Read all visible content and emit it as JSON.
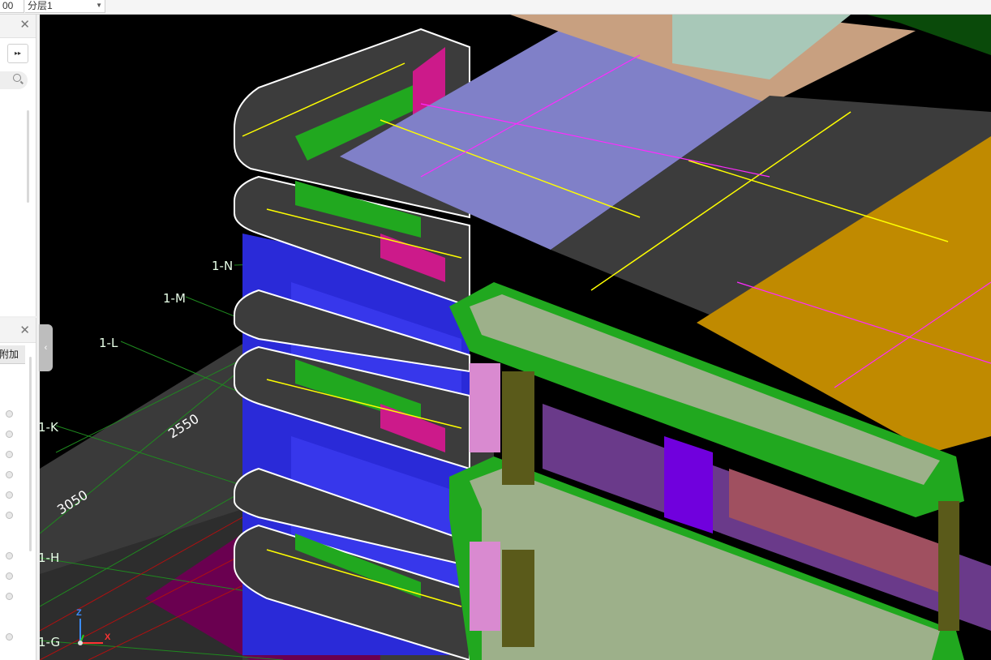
{
  "toolbar": {
    "scale_value": "00",
    "layer_value": "分层1"
  },
  "left_panel_bottom": {
    "tab_label": "附加"
  },
  "viewport": {
    "axis_labels": [
      "1-N",
      "1-M",
      "1-L",
      "1-K",
      "1-H",
      "1-G"
    ],
    "dimensions": [
      "2550",
      "3050"
    ],
    "coord_axes": {
      "z": "Z",
      "x": "X"
    }
  },
  "colors": {
    "slab_dark": "#3c3c3c",
    "beam_green": "#21a81f",
    "wall_blue": "#2626d8",
    "column_magenta": "#cc1a8a",
    "roof_lavender": "#8080c8",
    "floor_orange": "#c08a00",
    "balcony_sage": "#9db08a",
    "grid_green": "#1f8a1f"
  }
}
